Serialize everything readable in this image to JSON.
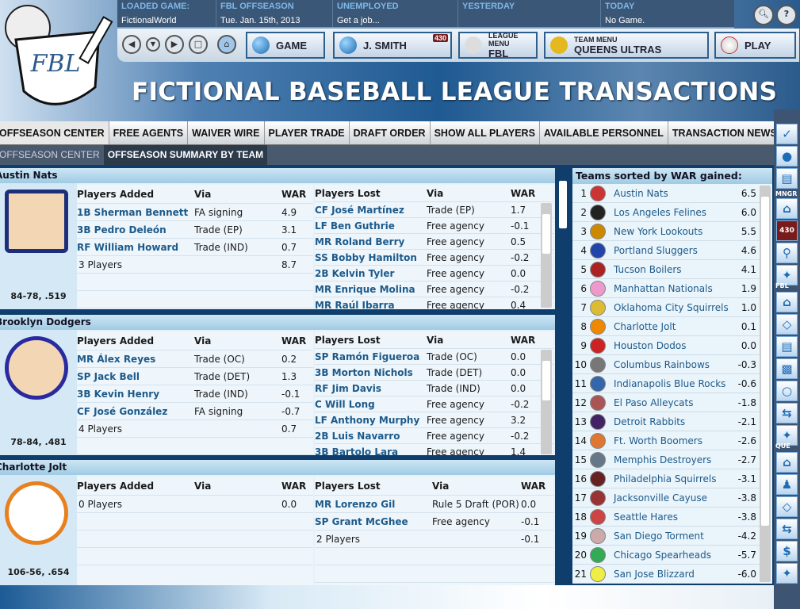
{
  "header": {
    "info": [
      {
        "label": "LOADED GAME:",
        "value": "FictionalWorld"
      },
      {
        "label": "FBL OFFSEASON",
        "value": "Tue. Jan. 15th, 2013"
      },
      {
        "label": "UNEMPLOYED",
        "value": "Get a job..."
      },
      {
        "label": "YESTERDAY",
        "value": ""
      },
      {
        "label": "TODAY",
        "value": "No Game."
      }
    ],
    "logo_text": "FBL",
    "nav": {
      "game": "GAME",
      "manager": "J. SMITH",
      "manager_badge": "430",
      "league_menu_label": "LEAGUE MENU",
      "league": "FBL",
      "team_menu_label": "TEAM MENU",
      "team": "QUEENS ULTRAS",
      "play": "PLAY"
    },
    "title": "FICTIONAL BASEBALL LEAGUE TRANSACTIONS"
  },
  "tabs": [
    "OFFSEASON CENTER",
    "FREE AGENTS",
    "WAIVER WIRE",
    "PLAYER TRADE",
    "DRAFT ORDER",
    "SHOW ALL PLAYERS",
    "AVAILABLE PERSONNEL",
    "TRANSACTION NEWS"
  ],
  "subtabs": [
    "OFFSEASON CENTER",
    "OFFSEASON SUMMARY BY TEAM"
  ],
  "cols": {
    "added": "Players Added",
    "lost": "Players Lost",
    "via": "Via",
    "war": "WAR"
  },
  "teams": [
    {
      "name": "Austin Nats",
      "record": "84-78, .519",
      "color": "#1d2f7a",
      "added": [
        [
          "1B Sherman Bennett",
          "FA signing",
          "4.9"
        ],
        [
          "3B Pedro Deleón",
          "Trade (EP)",
          "3.1"
        ],
        [
          "RF William Howard",
          "Trade (IND)",
          "0.7"
        ]
      ],
      "added_total": [
        "3 Players",
        "8.7"
      ],
      "lost": [
        [
          "CF José Martínez",
          "Trade (EP)",
          "1.7"
        ],
        [
          "LF Ben Guthrie",
          "Free agency",
          "-0.1"
        ],
        [
          "MR Roland Berry",
          "Free agency",
          "0.5"
        ],
        [
          "SS Bobby Hamilton",
          "Free agency",
          "-0.2"
        ],
        [
          "2B Kelvin Tyler",
          "Free agency",
          "0.0"
        ],
        [
          "MR Enrique Molina",
          "Free agency",
          "-0.2"
        ],
        [
          "MR Raúl Ibarra",
          "Free agency",
          "0.4"
        ]
      ]
    },
    {
      "name": "Brooklyn Dodgers",
      "record": "78-84, .481",
      "color": "#2a2aa0",
      "added": [
        [
          "MR Álex Reyes",
          "Trade (OC)",
          "0.2"
        ],
        [
          "SP Jack Bell",
          "Trade (DET)",
          "1.3"
        ],
        [
          "3B Kevin Henry",
          "Trade (IND)",
          "-0.1"
        ],
        [
          "CF José González",
          "FA signing",
          "-0.7"
        ]
      ],
      "added_total": [
        "4 Players",
        "0.7"
      ],
      "lost": [
        [
          "SP Ramón Figueroa",
          "Trade (OC)",
          "0.0"
        ],
        [
          "3B Morton Nichols",
          "Trade (DET)",
          "0.0"
        ],
        [
          "RF Jim Davis",
          "Trade (IND)",
          "0.0"
        ],
        [
          "C Will Long",
          "Free agency",
          "-0.2"
        ],
        [
          "LF Anthony Murphy",
          "Free agency",
          "3.2"
        ],
        [
          "2B Luis Navarro",
          "Free agency",
          "-0.2"
        ],
        [
          "3B Bartolo Lara",
          "Free agency",
          "1.4"
        ]
      ]
    },
    {
      "name": "Charlotte Jolt",
      "record": "106-56, .654",
      "color": "#e8801e",
      "added": [],
      "added_total": [
        "0 Players",
        "0.0"
      ],
      "lost": [
        [
          "MR Lorenzo Gil",
          "Rule 5 Draft (POR)",
          "0.0"
        ],
        [
          "SP Grant McGhee",
          "Free agency",
          "-0.1"
        ]
      ],
      "lost_total": [
        "2 Players",
        "-0.1"
      ]
    }
  ],
  "ranking": {
    "title": "Teams sorted by WAR gained:",
    "rows": [
      [
        "1",
        "Austin Nats",
        "6.5"
      ],
      [
        "2",
        "Los Angeles Felines",
        "6.0"
      ],
      [
        "3",
        "New York Lookouts",
        "5.5"
      ],
      [
        "4",
        "Portland Sluggers",
        "4.6"
      ],
      [
        "5",
        "Tucson Boilers",
        "4.1"
      ],
      [
        "6",
        "Manhattan Nationals",
        "1.9"
      ],
      [
        "7",
        "Oklahoma City Squirrels",
        "1.0"
      ],
      [
        "8",
        "Charlotte Jolt",
        "0.1"
      ],
      [
        "9",
        "Houston Dodos",
        "0.0"
      ],
      [
        "10",
        "Columbus Rainbows",
        "-0.3"
      ],
      [
        "11",
        "Indianapolis Blue Rocks",
        "-0.6"
      ],
      [
        "12",
        "El Paso Alleycats",
        "-1.8"
      ],
      [
        "13",
        "Detroit Rabbits",
        "-2.1"
      ],
      [
        "14",
        "Ft. Worth Boomers",
        "-2.6"
      ],
      [
        "15",
        "Memphis Destroyers",
        "-2.7"
      ],
      [
        "16",
        "Philadelphia Squirrels",
        "-3.1"
      ],
      [
        "17",
        "Jacksonville Cayuse",
        "-3.8"
      ],
      [
        "18",
        "Seattle Hares",
        "-3.8"
      ],
      [
        "19",
        "San Diego Torment",
        "-4.2"
      ],
      [
        "20",
        "Chicago Spearheads",
        "-5.7"
      ],
      [
        "21",
        "San Jose Blizzard",
        "-6.0"
      ]
    ]
  },
  "sidebar": {
    "sections": [
      "MNGR",
      "FBL",
      "QUE"
    ],
    "badge": "430"
  }
}
